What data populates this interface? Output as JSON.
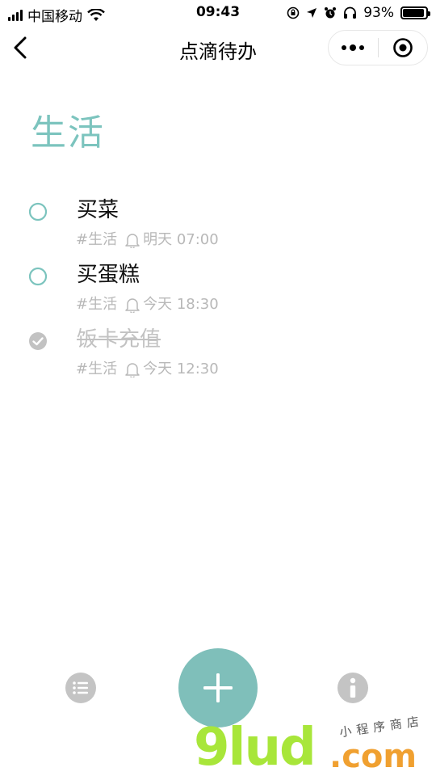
{
  "status_bar": {
    "carrier": "中国移动",
    "time": "09:43",
    "battery_percent": "93%",
    "battery_level": 0.93,
    "icons": [
      "signal-icon",
      "wifi-icon",
      "rotation-lock-icon",
      "location-icon",
      "alarm-icon",
      "headphones-icon",
      "battery-icon"
    ]
  },
  "nav": {
    "title": "点滴待办",
    "back_icon": "chevron-left-icon",
    "more_icon": "more-dots-icon",
    "close_icon": "target-icon"
  },
  "group": {
    "title": "生活"
  },
  "tasks": [
    {
      "title": "买菜",
      "tag": "#生活",
      "reminder": "明天 07:00",
      "done": false
    },
    {
      "title": "买蛋糕",
      "tag": "#生活",
      "reminder": "今天 18:30",
      "done": false
    },
    {
      "title": "饭卡充值",
      "tag": "#生活",
      "reminder": "今天 12:30",
      "done": true
    }
  ],
  "bottom_bar": {
    "list_icon": "list-icon",
    "add_icon": "plus-icon",
    "info_icon": "info-icon"
  },
  "watermark": {
    "logo": "9lud",
    "domain": ".com",
    "caption": "小程序商店"
  },
  "colors": {
    "accent": "#7cc4be",
    "add_button": "#7fbfba",
    "muted": "#b8b8b8",
    "done_text": "#c2c2c2"
  }
}
